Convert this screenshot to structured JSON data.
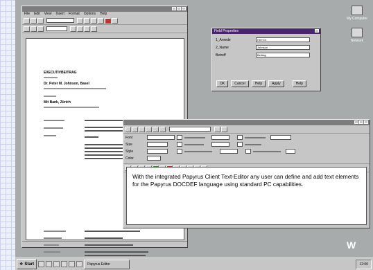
{
  "editor": {
    "menu": [
      "File",
      "Edit",
      "View",
      "Insert",
      "Format",
      "Options",
      "Help"
    ],
    "doc": {
      "heading": "EXECUTIVBEITRAG",
      "line_a": "Dr. Peter M. Johnson, Basel",
      "line_b": "Mit Bank, Zürich"
    }
  },
  "dialog": {
    "title": "Field Properties",
    "rows": [
      "1_Anrede",
      "2_Name",
      "Betreff"
    ],
    "values": [
      "Herr Dr.",
      "Johnson",
      "Beitrag"
    ],
    "buttons": [
      "OK",
      "Cancel",
      "Help",
      "Apply",
      "Help"
    ]
  },
  "property_window": {
    "field_labels": [
      "Font",
      "Size",
      "Style",
      "Color"
    ],
    "body_text": "With the integrated Papyrus Client Text-Editor any user can define and add text elements for the Papyrus DOCDEF language using standard PC capabilities."
  },
  "taskbar": {
    "start_label": "Start",
    "task_label": "Papyrus Editor",
    "clock": "12:00"
  },
  "desktop_icons": [
    {
      "name": "My Computer",
      "icon": "computer-icon"
    },
    {
      "name": "Network",
      "icon": "network-icon"
    }
  ],
  "brand_mark": "W",
  "colors": {
    "desktop": "#a7abab",
    "active_title": "#48246b"
  }
}
